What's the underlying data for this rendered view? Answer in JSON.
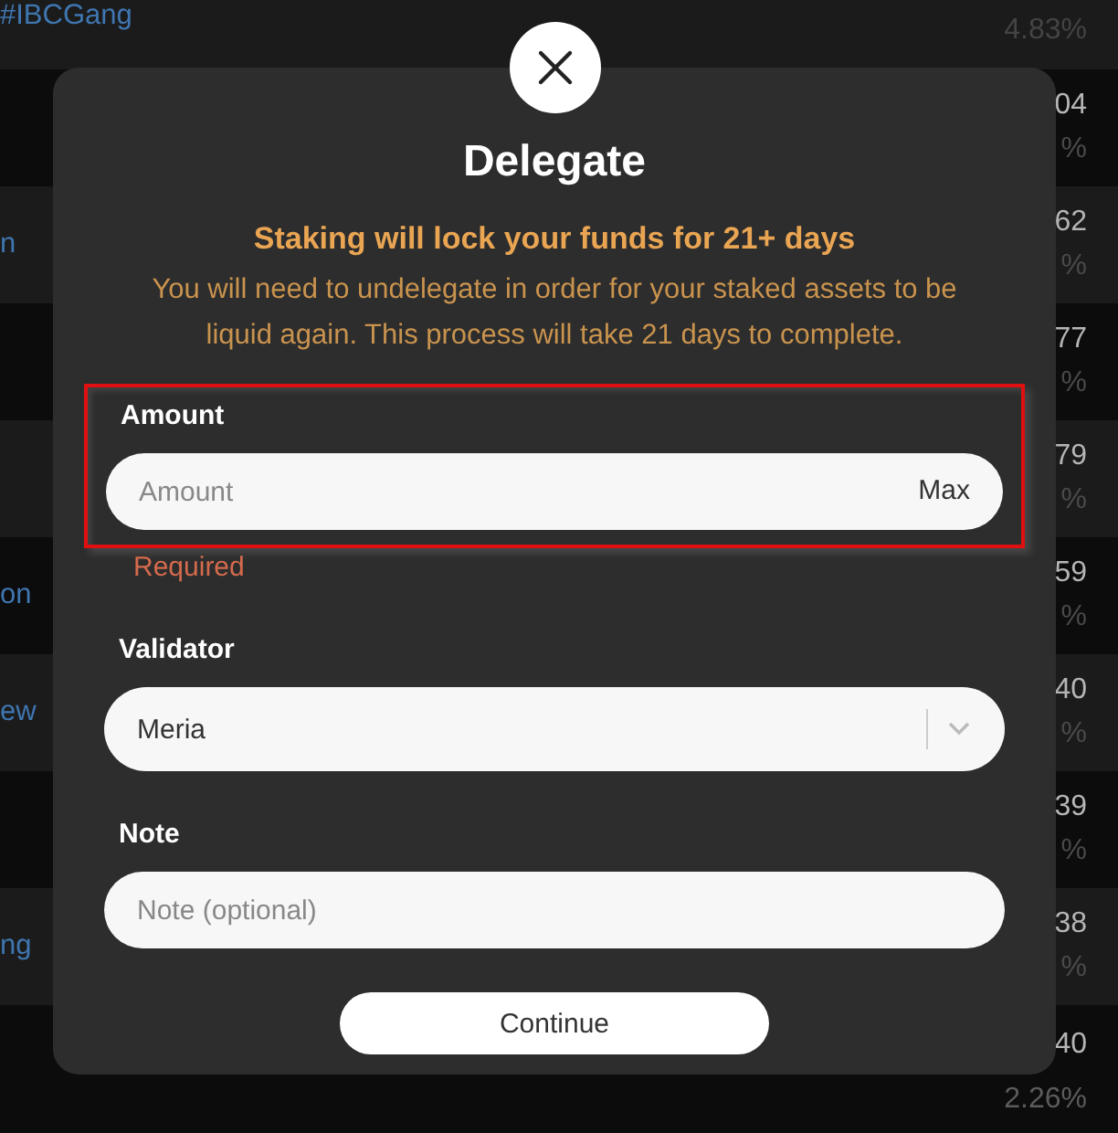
{
  "background_table": {
    "rows": [
      {
        "left": "#IBCGang",
        "value": "",
        "percent": "4.83%"
      },
      {
        "left": "",
        "value": "04",
        "percent": "%"
      },
      {
        "left": "n",
        "value": "62",
        "percent": "%"
      },
      {
        "left": "",
        "value": "77",
        "percent": "%"
      },
      {
        "left": "",
        "value": "79",
        "percent": "%"
      },
      {
        "left": "on",
        "value": "59",
        "percent": "%"
      },
      {
        "left": "ew",
        "value": "40",
        "percent": "%"
      },
      {
        "left": "",
        "value": "39",
        "percent": "%"
      },
      {
        "left": "ng",
        "value": "38",
        "percent": "%"
      },
      {
        "left": "",
        "value": "40",
        "percent": "2.26%"
      }
    ]
  },
  "dialog": {
    "title": "Delegate",
    "warning": "Staking will lock your funds for 21+ days",
    "description": "You will need to undelegate in order for your staked assets to be liquid again. This process will take 21 days to complete.",
    "amount": {
      "label": "Amount",
      "placeholder": "Amount",
      "max": "Max",
      "error": "Required",
      "highlighted": true
    },
    "validator": {
      "label": "Validator",
      "value": "Meria"
    },
    "note": {
      "label": "Note",
      "placeholder": "Note (optional)"
    },
    "button": "Continue"
  }
}
